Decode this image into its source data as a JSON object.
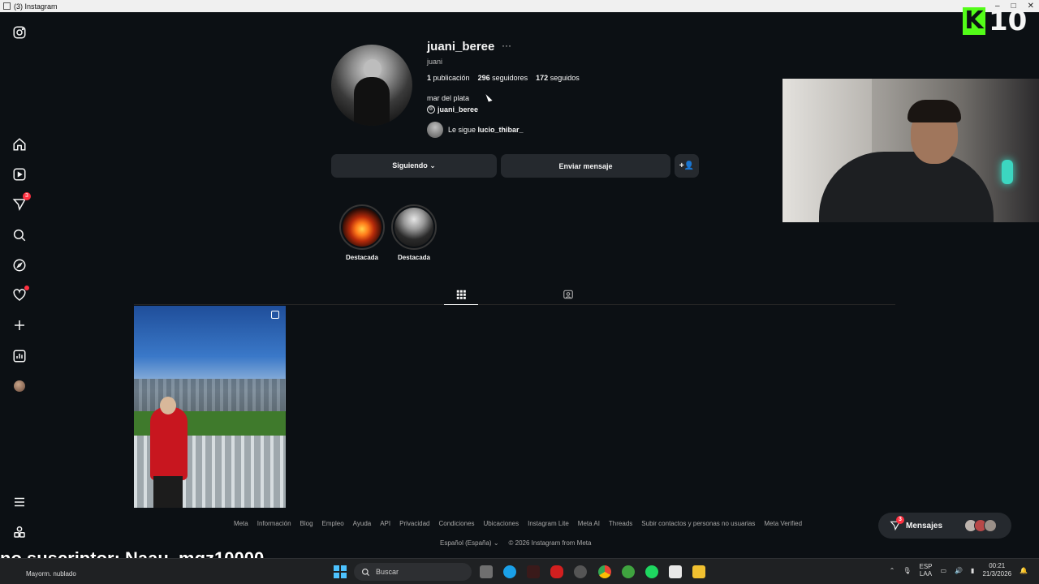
{
  "window": {
    "title": "(3) Instagram"
  },
  "sidebar": {
    "items": [
      {
        "name": "instagram-logo-icon"
      },
      {
        "name": "home-icon"
      },
      {
        "name": "reels-icon"
      },
      {
        "name": "messages-icon",
        "badge": "3"
      },
      {
        "name": "search-icon"
      },
      {
        "name": "explore-icon"
      },
      {
        "name": "notifications-icon"
      },
      {
        "name": "create-icon"
      },
      {
        "name": "dashboard-icon"
      },
      {
        "name": "profile-avatar"
      },
      {
        "name": "menu-icon"
      },
      {
        "name": "also-from-meta-icon"
      }
    ]
  },
  "profile": {
    "username": "juani_beree",
    "more": "···",
    "full_name": "juani",
    "stats": {
      "posts_count": "1",
      "posts_label": "publicación",
      "followers_count": "296",
      "followers_label": "seguidores",
      "following_count": "172",
      "following_label": "seguidos"
    },
    "bio": "mar del plata",
    "threads_handle": "juani_beree",
    "followed_by_prefix": "Le sigue",
    "followed_by_user": "lucio_thibar_",
    "buttons": {
      "following": "Siguiendo ⌄",
      "message": "Enviar mensaje",
      "add_user": "+👤"
    }
  },
  "highlights": [
    {
      "label": "Destacada"
    },
    {
      "label": "Destacada"
    }
  ],
  "tabs": [
    {
      "name": "posts-grid-icon",
      "active": true
    },
    {
      "name": "tagged-icon",
      "active": false
    }
  ],
  "posts": [
    {
      "type": "carousel"
    }
  ],
  "footer": {
    "links": [
      "Meta",
      "Información",
      "Blog",
      "Empleo",
      "Ayuda",
      "API",
      "Privacidad",
      "Condiciones",
      "Ubicaciones",
      "Instagram Lite",
      "Meta AI",
      "Threads",
      "Subir contactos y personas no usuarias",
      "Meta Verified"
    ],
    "language": "Español (España) ⌄",
    "copyright": "© 2026 Instagram from Meta"
  },
  "messages_pill": {
    "label": "Mensajes",
    "badge": "3"
  },
  "stream": {
    "kick_number": "10",
    "overlay_text": "no suscriptor: Naau_mqz10000"
  },
  "taskbar": {
    "weather": "Mayorm. nublado",
    "search_placeholder": "Buscar",
    "lang_top": "ESP",
    "lang_bottom": "LAA",
    "time": "00:21",
    "date": "21/3/2026"
  },
  "colors": {
    "background": "#0c1014",
    "button": "#25292e",
    "badge": "#ff3040",
    "kick_green": "#53fc18"
  }
}
